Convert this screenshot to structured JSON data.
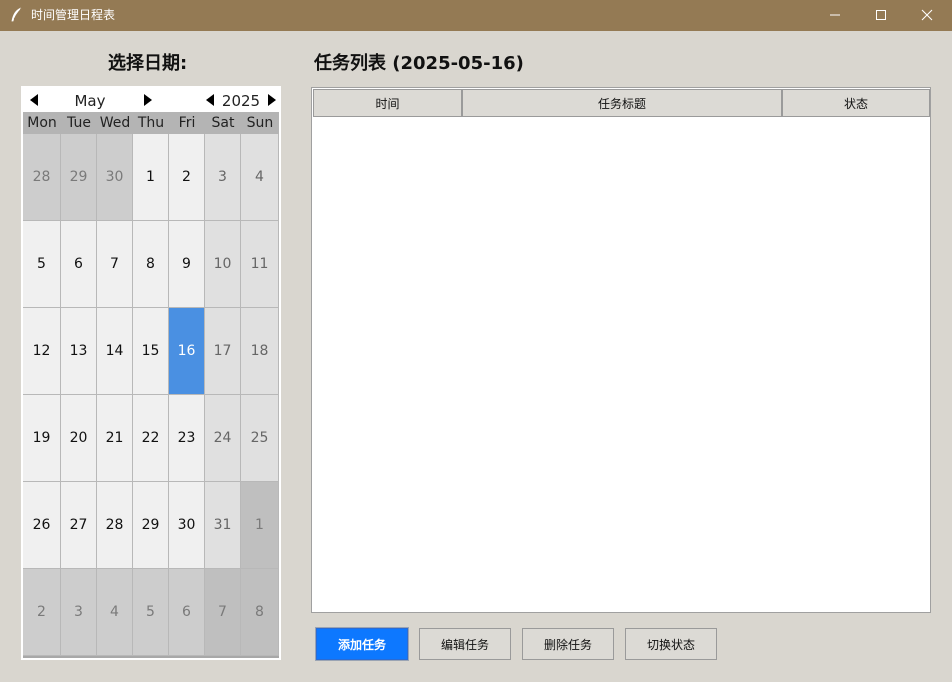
{
  "window": {
    "title": "时间管理日程表"
  },
  "date_section": {
    "heading": "选择日期:"
  },
  "calendar": {
    "month": "May",
    "year": "2025",
    "weekdays": [
      "Mon",
      "Tue",
      "Wed",
      "Thu",
      "Fri",
      "Sat",
      "Sun"
    ],
    "weeks": [
      [
        {
          "d": "28",
          "t": "other"
        },
        {
          "d": "29",
          "t": "other"
        },
        {
          "d": "30",
          "t": "other"
        },
        {
          "d": "1",
          "t": "weekday"
        },
        {
          "d": "2",
          "t": "weekday"
        },
        {
          "d": "3",
          "t": "weekend"
        },
        {
          "d": "4",
          "t": "weekend"
        }
      ],
      [
        {
          "d": "5",
          "t": "weekday"
        },
        {
          "d": "6",
          "t": "weekday"
        },
        {
          "d": "7",
          "t": "weekday"
        },
        {
          "d": "8",
          "t": "weekday"
        },
        {
          "d": "9",
          "t": "weekday"
        },
        {
          "d": "10",
          "t": "weekend"
        },
        {
          "d": "11",
          "t": "weekend"
        }
      ],
      [
        {
          "d": "12",
          "t": "weekday"
        },
        {
          "d": "13",
          "t": "weekday"
        },
        {
          "d": "14",
          "t": "weekday"
        },
        {
          "d": "15",
          "t": "weekday"
        },
        {
          "d": "16",
          "t": "selected"
        },
        {
          "d": "17",
          "t": "weekend"
        },
        {
          "d": "18",
          "t": "weekend"
        }
      ],
      [
        {
          "d": "19",
          "t": "weekday"
        },
        {
          "d": "20",
          "t": "weekday"
        },
        {
          "d": "21",
          "t": "weekday"
        },
        {
          "d": "22",
          "t": "weekday"
        },
        {
          "d": "23",
          "t": "weekday"
        },
        {
          "d": "24",
          "t": "weekend"
        },
        {
          "d": "25",
          "t": "weekend"
        }
      ],
      [
        {
          "d": "26",
          "t": "weekday"
        },
        {
          "d": "27",
          "t": "weekday"
        },
        {
          "d": "28",
          "t": "weekday"
        },
        {
          "d": "29",
          "t": "weekday"
        },
        {
          "d": "30",
          "t": "weekday"
        },
        {
          "d": "31",
          "t": "weekend"
        },
        {
          "d": "1",
          "t": "other-weekend"
        }
      ],
      [
        {
          "d": "2",
          "t": "other"
        },
        {
          "d": "3",
          "t": "other"
        },
        {
          "d": "4",
          "t": "other"
        },
        {
          "d": "5",
          "t": "other"
        },
        {
          "d": "6",
          "t": "other"
        },
        {
          "d": "7",
          "t": "other-weekend"
        },
        {
          "d": "8",
          "t": "other-weekend"
        }
      ]
    ]
  },
  "tasks": {
    "heading": "任务列表 (2025-05-16)",
    "columns": [
      "时间",
      "任务标题",
      "状态"
    ],
    "rows": []
  },
  "buttons": {
    "add": "添加任务",
    "edit": "编辑任务",
    "delete": "删除任务",
    "toggle": "切换状态"
  },
  "colors": {
    "titlebar": "#947a54",
    "selected_day": "#4a90e2",
    "primary_button": "#0d78ff"
  },
  "icons": {
    "app": "feather-icon",
    "prev_month": "triangle-left-icon",
    "next_month": "triangle-right-icon",
    "prev_year": "triangle-left-icon",
    "next_year": "triangle-right-icon"
  }
}
